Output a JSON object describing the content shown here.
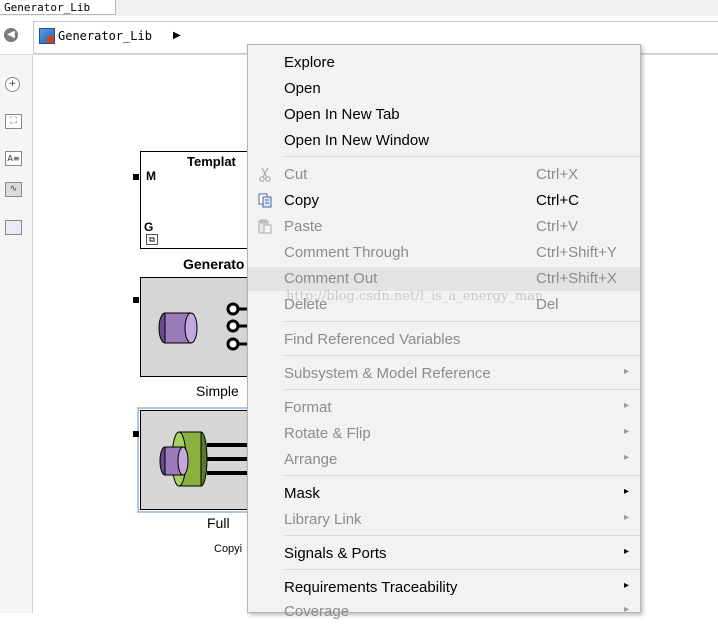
{
  "tab": {
    "title": "Generator_Lib"
  },
  "address": {
    "breadcrumb": "Generator_Lib",
    "arrow": "▶"
  },
  "palette": {
    "text_icon": "A≡"
  },
  "canvas": {
    "template_block": {
      "title": "Templat",
      "port_m": "M",
      "port_g": "G",
      "caption": "Generato"
    },
    "simple_block": {
      "caption": "Simple"
    },
    "full_block": {
      "caption": "Full",
      "copyright": "Copyi"
    }
  },
  "context_menu": {
    "items": [
      {
        "label": "Explore",
        "shortcut": "",
        "enabled": true,
        "submenu": false
      },
      {
        "label": "Open",
        "shortcut": "",
        "enabled": true,
        "submenu": false
      },
      {
        "label": "Open In New Tab",
        "shortcut": "",
        "enabled": true,
        "submenu": false
      },
      {
        "label": "Open In New Window",
        "shortcut": "",
        "enabled": true,
        "submenu": false
      },
      {
        "label": "Cut",
        "shortcut": "Ctrl+X",
        "enabled": false,
        "submenu": false,
        "icon": "scissors-icon"
      },
      {
        "label": "Copy",
        "shortcut": "Ctrl+C",
        "enabled": true,
        "submenu": false,
        "icon": "copy-icon"
      },
      {
        "label": "Paste",
        "shortcut": "Ctrl+V",
        "enabled": false,
        "submenu": false,
        "icon": "paste-icon"
      },
      {
        "label": "Comment Through",
        "shortcut": "Ctrl+Shift+Y",
        "enabled": false,
        "submenu": false
      },
      {
        "label": "Comment Out",
        "shortcut": "Ctrl+Shift+X",
        "enabled": false,
        "submenu": false,
        "highlighted": true
      },
      {
        "label": "Delete",
        "shortcut": "Del",
        "enabled": false,
        "submenu": false
      },
      {
        "label": "Find Referenced Variables",
        "shortcut": "",
        "enabled": false,
        "submenu": false
      },
      {
        "label": "Subsystem & Model Reference",
        "shortcut": "",
        "enabled": false,
        "submenu": true
      },
      {
        "label": "Format",
        "shortcut": "",
        "enabled": false,
        "submenu": true
      },
      {
        "label": "Rotate & Flip",
        "shortcut": "",
        "enabled": false,
        "submenu": true
      },
      {
        "label": "Arrange",
        "shortcut": "",
        "enabled": false,
        "submenu": true
      },
      {
        "label": "Mask",
        "shortcut": "",
        "enabled": true,
        "submenu": true
      },
      {
        "label": "Library Link",
        "shortcut": "",
        "enabled": false,
        "submenu": true
      },
      {
        "label": "Signals & Ports",
        "shortcut": "",
        "enabled": true,
        "submenu": true
      },
      {
        "label": "Requirements Traceability",
        "shortcut": "",
        "enabled": true,
        "submenu": true
      },
      {
        "label": "Coverage",
        "shortcut": "",
        "enabled": false,
        "submenu": true
      }
    ],
    "submenu_arrow": "▸"
  },
  "watermark": "http://blog.csdn.net/I_is_a_energy_man"
}
